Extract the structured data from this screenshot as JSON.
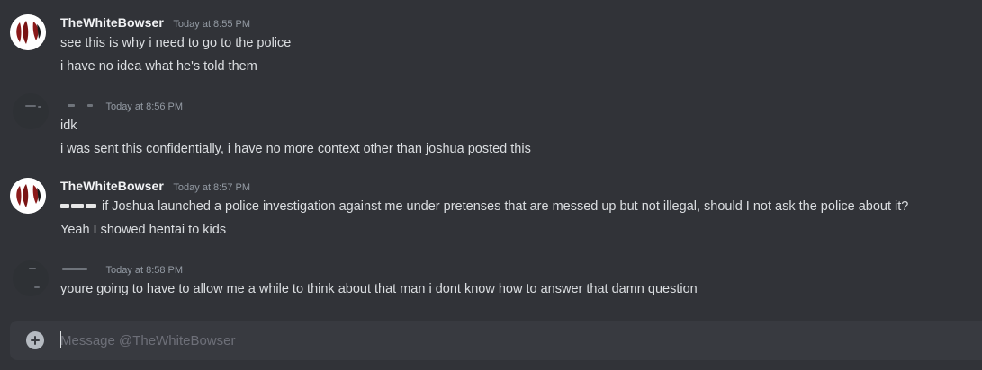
{
  "messages": [
    {
      "author": "TheWhiteBowser",
      "author_visible": true,
      "timestamp": "Today at 8:55 PM",
      "lines": [
        "see this is why i need to go to the police",
        "i have no idea what he's told them"
      ]
    },
    {
      "author": "",
      "author_visible": false,
      "timestamp": "Today at 8:56 PM",
      "lines": [
        "idk",
        "i was sent this confidentially, i have no more context other than joshua posted this"
      ]
    },
    {
      "author": "TheWhiteBowser",
      "author_visible": true,
      "timestamp": "Today at 8:57 PM",
      "lines": [
        "if Joshua launched a police investigation against me under pretenses that are messed up but not illegal, should I not ask the police about it?",
        "Yeah I showed hentai to kids"
      ]
    },
    {
      "author": "",
      "author_visible": false,
      "timestamp": "Today at 8:58 PM",
      "lines": [
        "youre going to have to allow me a while to think about that man i dont know how to answer that damn question"
      ]
    }
  ],
  "composer": {
    "placeholder": "Message @TheWhiteBowser",
    "value": ""
  },
  "icons": {
    "add": "plus-circle-icon",
    "avatar": "bowser-emblem-avatar"
  },
  "colors": {
    "background": "#313338",
    "composer_bg": "#383a40",
    "username": "#f2f3f5",
    "text": "#dbdee1",
    "timestamp": "#949ba4",
    "avatar_accent": "#8b1a1a"
  }
}
